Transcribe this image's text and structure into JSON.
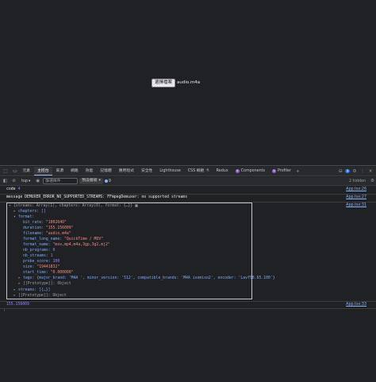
{
  "page": {
    "file_button": "選擇檔案",
    "file_name": "audio.m4a"
  },
  "devtools": {
    "tabs": [
      {
        "label": "元素",
        "name": "tab-elements",
        "active": false
      },
      {
        "label": "主控台",
        "name": "tab-console",
        "active": true
      },
      {
        "label": "來源",
        "name": "tab-sources",
        "active": false
      },
      {
        "label": "網路",
        "name": "tab-network",
        "active": false
      },
      {
        "label": "效能",
        "name": "tab-performance",
        "active": false
      },
      {
        "label": "記憶體",
        "name": "tab-memory",
        "active": false
      },
      {
        "label": "應用程式",
        "name": "tab-application",
        "active": false
      },
      {
        "label": "安全性",
        "name": "tab-security",
        "active": false
      },
      {
        "label": "Lighthouse",
        "name": "tab-lighthouse",
        "active": false
      },
      {
        "label": "CSS 概觀",
        "name": "tab-css-overview",
        "active": false
      },
      {
        "label": "Redux",
        "name": "tab-redux",
        "active": false
      },
      {
        "label": "Components",
        "name": "tab-components",
        "active": false
      },
      {
        "label": "Profiler",
        "name": "tab-profiler",
        "active": false
      }
    ],
    "issue_count": "9",
    "toolbar": {
      "context": "top",
      "filter_placeholder": "篩選條件",
      "levels": "預設層級",
      "issues_count": "9",
      "hidden": "2 hidden"
    },
    "console": {
      "lines": {
        "code_key": "code",
        "code_val": "4",
        "message_key": "message",
        "message_val": "DEMUXER_ERROR_NO_SUPPORTED_STREAMS: FFmpegDemuxer: no supported streams",
        "summary": "{streams: Array(1), chapters: Array(0), format: {…}}",
        "chapters": "chapters: []",
        "format": "format:",
        "bit_rate_k": "bit_rate:",
        "bit_rate_v": "\"100264O\"",
        "duration_k": "duration:",
        "duration_v": "\"155.156009\"",
        "filename_k": "filename:",
        "filename_v": "\"audio.m4a\"",
        "format_long_name_k": "format_long_name:",
        "format_long_name_v": "\"QuickTime / MOV\"",
        "format_name_k": "format_name:",
        "format_name_v": "\"mov,mp4,m4a,3gp,3g2,mj2\"",
        "nb_programs_k": "nb_programs:",
        "nb_programs_v": "0",
        "nb_streams_k": "nb_streams:",
        "nb_streams_v": "1",
        "probe_score_k": "probe_score:",
        "probe_score_v": "100",
        "size_k": "size:",
        "size_v": "\"19441832\"",
        "start_time_k": "start_time:",
        "start_time_v": "\"0.000000\"",
        "tags": "tags: {major_brand: 'M4A ', minor_version: '512', compatible_brands: 'M4A isomiso2', encoder: 'Lavf58.65.100'}",
        "proto1": "[[Prototype]]: Object",
        "streams": "streams: [{…}]",
        "proto2": "[[Prototype]]: Object",
        "duration_log": "155.156009"
      },
      "sources": {
        "code": "App.tsx:26",
        "message": "App.tsx:27",
        "object": "App.tsx:31",
        "duration": "App.tsx:33"
      }
    }
  }
}
